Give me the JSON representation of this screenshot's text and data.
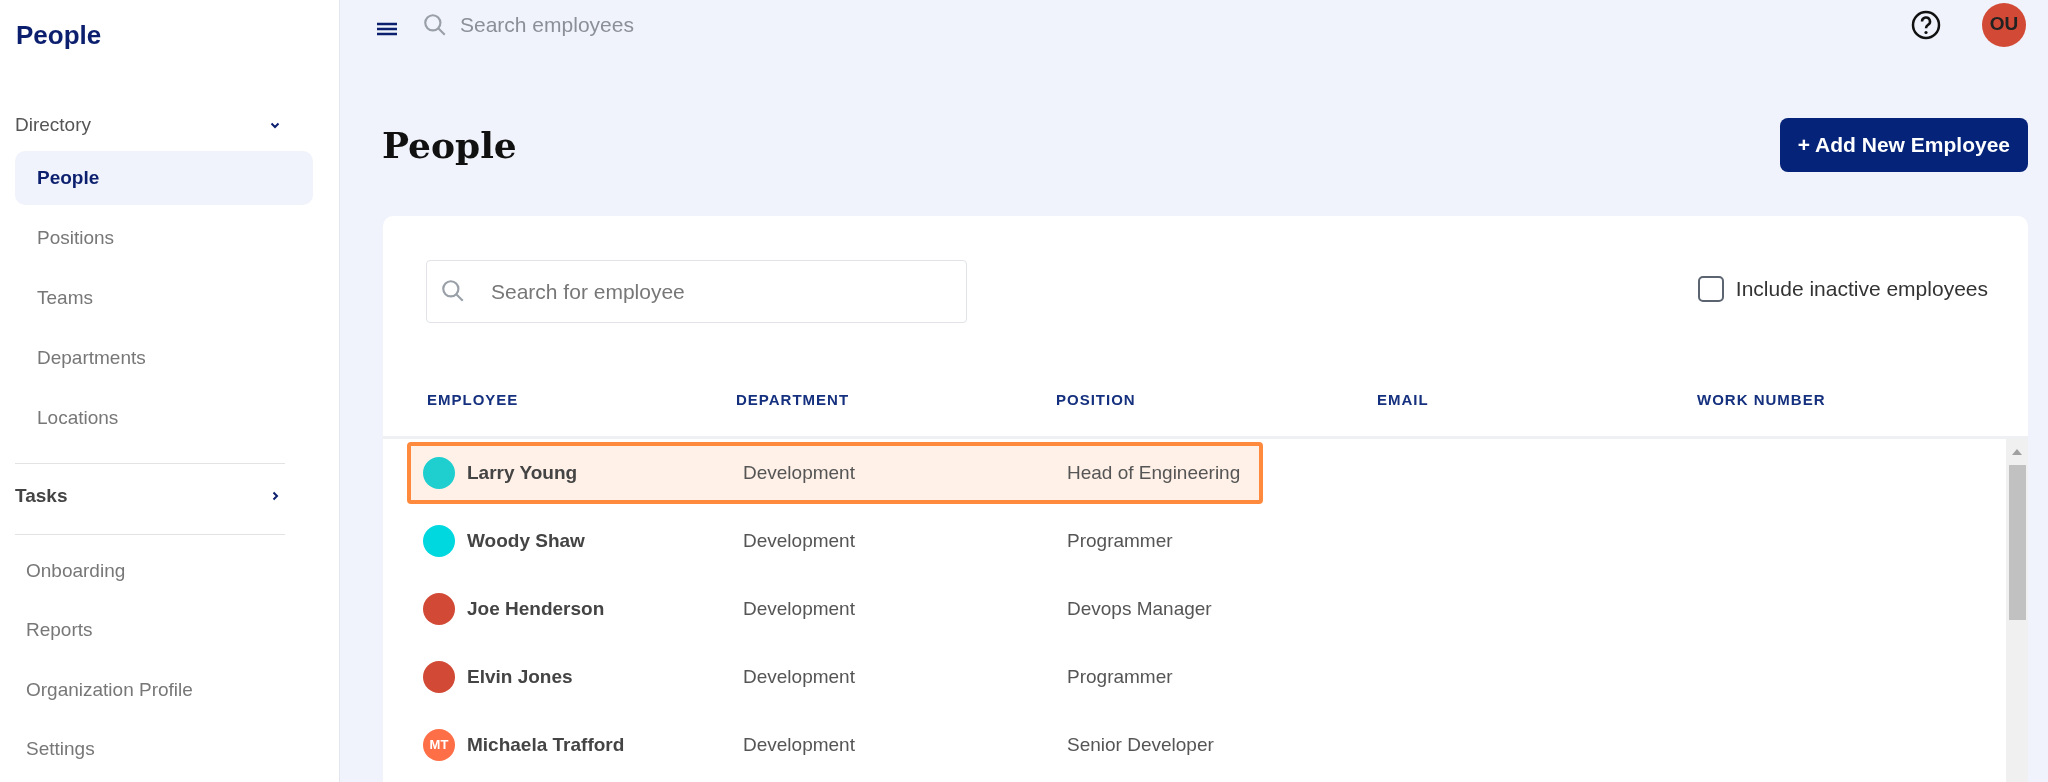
{
  "sidebar": {
    "title": "People",
    "groups": [
      {
        "label": "Directory",
        "expanded": true,
        "children": [
          {
            "label": "People",
            "selected": true
          },
          {
            "label": "Positions",
            "selected": false
          },
          {
            "label": "Teams",
            "selected": false
          },
          {
            "label": "Departments",
            "selected": false
          },
          {
            "label": "Locations",
            "selected": false
          }
        ]
      },
      {
        "label": "Tasks",
        "expanded": false
      }
    ],
    "links": [
      "Onboarding",
      "Reports",
      "Organization Profile",
      "Settings"
    ]
  },
  "topbar": {
    "search": {
      "placeholder": "Search employees"
    },
    "avatar": {
      "initials": "OU",
      "color": "#d24a36"
    }
  },
  "page": {
    "title": "People",
    "add_button": "+ Add New Employee"
  },
  "filters": {
    "search": {
      "placeholder": "Search for employee"
    },
    "include_inactive": {
      "label": "Include inactive employees",
      "checked": false
    }
  },
  "table": {
    "columns": [
      "EMPLOYEE",
      "DEPARTMENT",
      "POSITION",
      "EMAIL",
      "WORK NUMBER"
    ],
    "rows": [
      {
        "name": "Larry Young",
        "department": "Development",
        "position": "Head of Engineering",
        "selected": true,
        "avatar": {
          "kind": "dot",
          "color": "#1fcfcf"
        }
      },
      {
        "name": "Woody Shaw",
        "department": "Development",
        "position": "Programmer",
        "selected": false,
        "avatar": {
          "kind": "dot",
          "color": "#00d8e0"
        }
      },
      {
        "name": "Joe Henderson",
        "department": "Development",
        "position": "Devops Manager",
        "selected": false,
        "avatar": {
          "kind": "dot",
          "color": "#d24a36"
        }
      },
      {
        "name": "Elvin Jones",
        "department": "Development",
        "position": "Programmer",
        "selected": false,
        "avatar": {
          "kind": "dot",
          "color": "#d24a36"
        }
      },
      {
        "name": "Michaela Trafford",
        "department": "Development",
        "position": "Senior Developer",
        "selected": false,
        "avatar": {
          "kind": "initials",
          "initials": "MT",
          "color": "#ff6f47"
        }
      }
    ]
  }
}
